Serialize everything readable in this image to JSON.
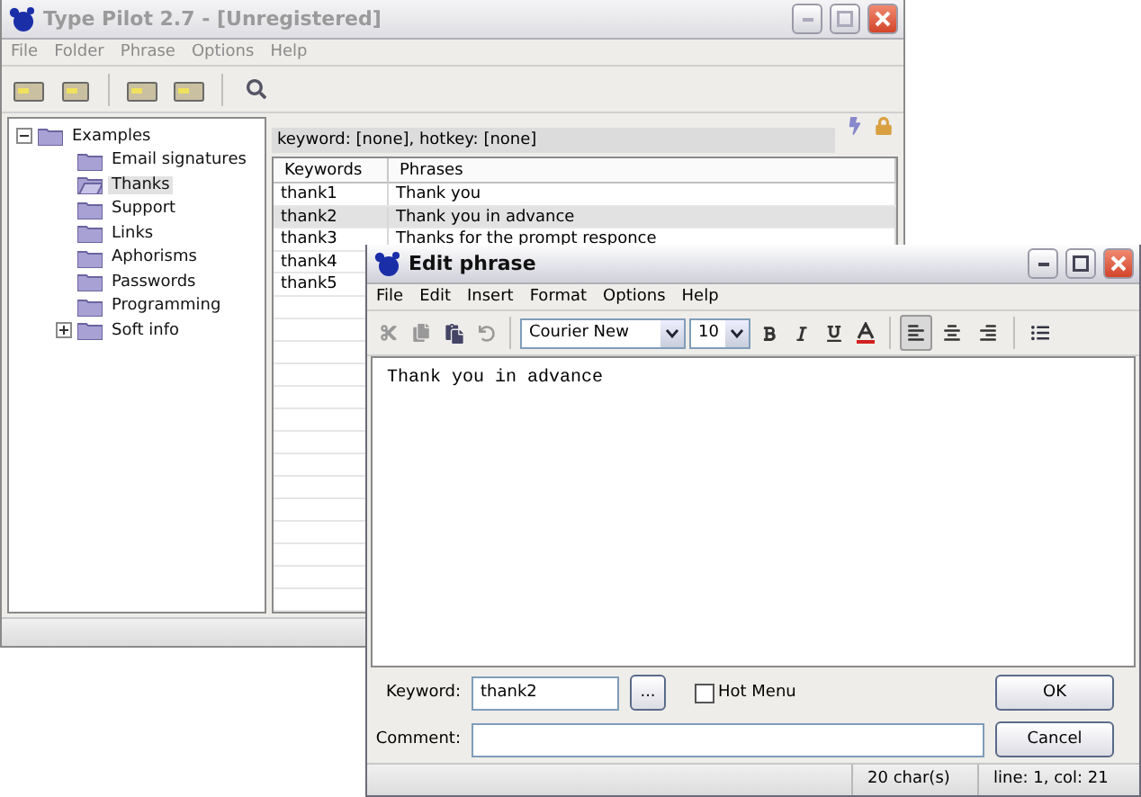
{
  "main_window": {
    "title": "Type Pilot 2.7 - [Unregistered]",
    "active": false,
    "menu": [
      "File",
      "Folder",
      "Phrase",
      "Options",
      "Help"
    ],
    "tree": [
      {
        "label": "Examples",
        "expanded": true,
        "selected": false,
        "children": [
          {
            "label": "Email signatures",
            "selected": false
          },
          {
            "label": "Thanks",
            "selected": true
          },
          {
            "label": "Support",
            "selected": false
          },
          {
            "label": "Links",
            "selected": false
          },
          {
            "label": "Aphorisms",
            "selected": false
          },
          {
            "label": "Passwords",
            "selected": false
          },
          {
            "label": "Programming",
            "selected": false
          },
          {
            "label": "Soft info",
            "selected": false,
            "expanded": false
          }
        ]
      }
    ],
    "info_bar": "keyword: [none],  hotkey: [none]",
    "table": {
      "columns": [
        "Keywords",
        "Phrases"
      ],
      "rows": [
        {
          "cells": [
            "thank1",
            "Thank you"
          ],
          "selected": false
        },
        {
          "cells": [
            "thank2",
            "Thank you in advance"
          ],
          "selected": true
        },
        {
          "cells": [
            "thank3",
            "Thanks for the prompt responce"
          ],
          "selected": false
        },
        {
          "cells": [
            "thank4",
            ""
          ],
          "selected": false
        },
        {
          "cells": [
            "thank5",
            ""
          ],
          "selected": false
        }
      ]
    }
  },
  "dialog": {
    "title": "Edit phrase",
    "active": true,
    "menu": [
      "File",
      "Edit",
      "Insert",
      "Format",
      "Options",
      "Help"
    ],
    "font": "Courier New",
    "size": "10",
    "alignment": [
      {
        "selected": true
      },
      {
        "selected": false
      },
      {
        "selected": false
      }
    ],
    "text": "Thank you in advance",
    "keyword_label": "Keyword:",
    "keyword": "thank2",
    "browse_button": "...",
    "hot_menu": {
      "label": "Hot Menu",
      "checked": false
    },
    "comment_label": "Comment:",
    "buttons": [
      "OK",
      "Cancel"
    ],
    "status": [
      "20 char(s)",
      "line: 1, col: 21"
    ]
  }
}
